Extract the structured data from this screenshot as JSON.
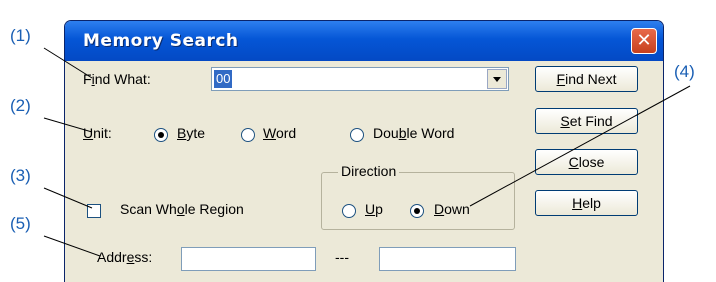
{
  "callouts": [
    "(1)",
    "(2)",
    "(3)",
    "(4)",
    "(5)"
  ],
  "window": {
    "title": "Memory Search",
    "close_glyph": "✕"
  },
  "find_what": {
    "label_pre": "F",
    "label_ul": "i",
    "label_post": "nd What:",
    "value": "00"
  },
  "unit": {
    "label_ul": "U",
    "label_post": "nit:",
    "options": [
      {
        "pre": "",
        "ul": "B",
        "post": "yte",
        "checked": true
      },
      {
        "pre": "",
        "ul": "W",
        "post": "ord",
        "checked": false
      },
      {
        "pre": "Dou",
        "ul": "b",
        "post": "le Word",
        "checked": false
      }
    ]
  },
  "scan": {
    "pre": "Scan Wh",
    "ul": "o",
    "post": "le Region",
    "checked": false
  },
  "direction": {
    "label": "Direction",
    "up": {
      "ul": "U",
      "post": "p",
      "checked": false
    },
    "down": {
      "ul": "D",
      "post": "own",
      "checked": true
    }
  },
  "address": {
    "pre": "Addr",
    "ul": "e",
    "post": "ss:",
    "separator": "---",
    "start": "",
    "end": ""
  },
  "buttons": [
    {
      "ul": "F",
      "post": "ind Next"
    },
    {
      "ul": "S",
      "post": "et Find"
    },
    {
      "ul": "C",
      "post": "lose"
    },
    {
      "ul": "H",
      "post": "elp"
    }
  ]
}
